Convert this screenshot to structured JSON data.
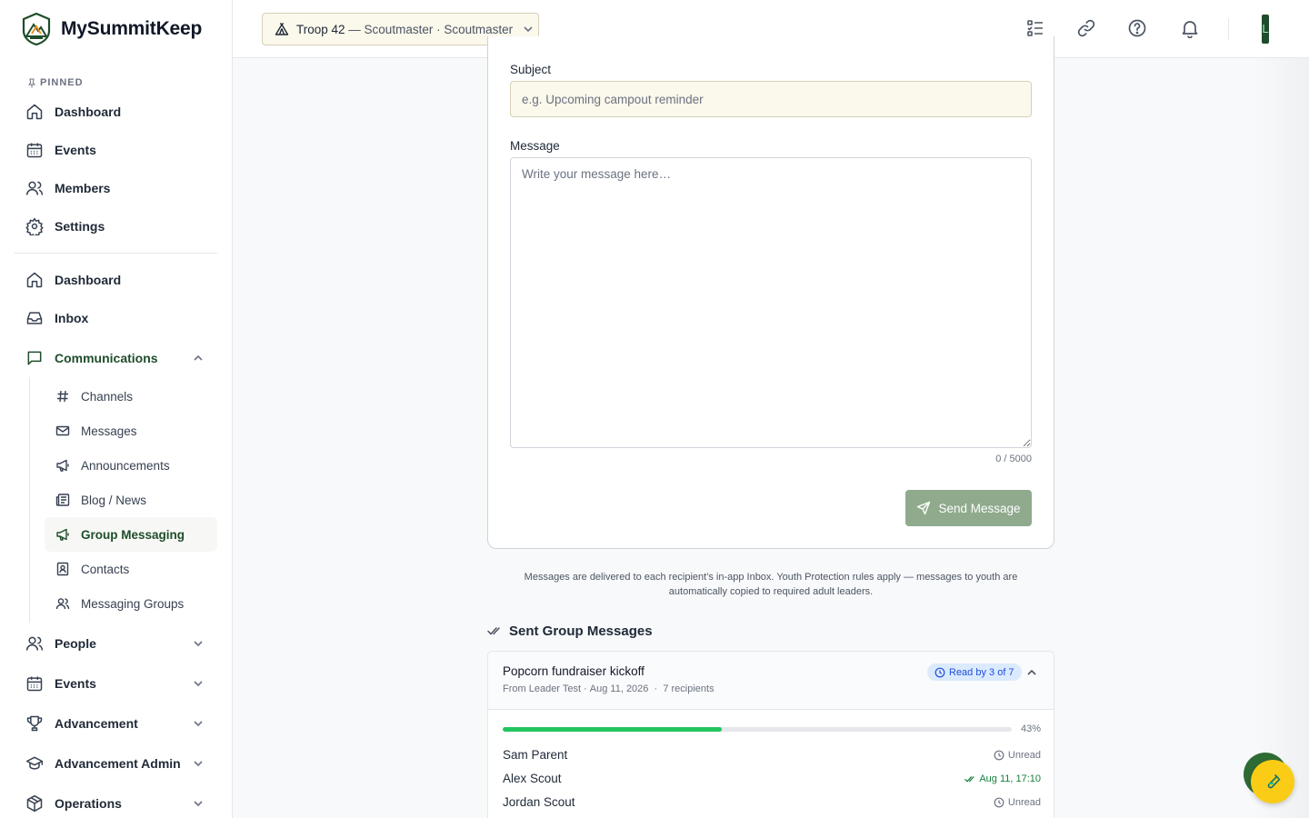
{
  "brand": {
    "name": "MySummitKeep"
  },
  "sidebar": {
    "pinned_label": "PINNED",
    "pinned": [
      {
        "label": "Dashboard",
        "icon": "home-icon"
      },
      {
        "label": "Events",
        "icon": "calendar-icon"
      },
      {
        "label": "Members",
        "icon": "users-icon"
      },
      {
        "label": "Settings",
        "icon": "gear-icon"
      }
    ],
    "main": [
      {
        "label": "Dashboard",
        "icon": "home-icon"
      },
      {
        "label": "Inbox",
        "icon": "inbox-icon"
      },
      {
        "label": "Communications",
        "icon": "chat-bubble-icon",
        "expanded": true,
        "active": true
      }
    ],
    "communications_sub": [
      {
        "label": "Channels",
        "icon": "hash-icon"
      },
      {
        "label": "Messages",
        "icon": "mail-icon"
      },
      {
        "label": "Announcements",
        "icon": "megaphone-icon"
      },
      {
        "label": "Blog / News",
        "icon": "newspaper-icon"
      },
      {
        "label": "Group Messaging",
        "icon": "megaphone-icon",
        "active": true
      },
      {
        "label": "Contacts",
        "icon": "contact-card-icon"
      },
      {
        "label": "Messaging Groups",
        "icon": "users-icon"
      }
    ],
    "sections": [
      {
        "label": "People",
        "icon": "users-icon"
      },
      {
        "label": "Events",
        "icon": "calendar-icon"
      },
      {
        "label": "Advancement",
        "icon": "trophy-icon"
      },
      {
        "label": "Advancement Admin",
        "icon": "graduation-cap-icon"
      },
      {
        "label": "Operations",
        "icon": "box-icon"
      }
    ]
  },
  "header": {
    "troop": "Troop 42",
    "troop_role": " — Scoutmaster · Scoutmaster",
    "avatar_initial": "L",
    "icons": [
      "checklist-icon",
      "link-icon",
      "help-icon",
      "bell-icon"
    ]
  },
  "compose": {
    "subject_label": "Subject",
    "subject_value": "",
    "subject_placeholder": "e.g. Upcoming campout reminder",
    "message_label": "Message",
    "message_value": "",
    "message_placeholder": "Write your message here…",
    "counter": "0 / 5000",
    "send_label": "Send Message"
  },
  "notice": "Messages are delivered to each recipient's in-app Inbox. Youth Protection rules apply — messages to youth are automatically copied to required adult leaders.",
  "sent": {
    "title": "Sent Group Messages",
    "messages": [
      {
        "subject": "Popcorn fundraiser kickoff",
        "from": "From Leader Test · ",
        "date": "Aug 11, 2026",
        "separator": "  ·  ",
        "recipients_count": "7 recipients",
        "read_badge": "Read by 3 of 7",
        "progress_percent": 43,
        "progress_label": "43%",
        "recipients": [
          {
            "name": "Sam Parent",
            "status": "Unread",
            "read": false
          },
          {
            "name": "Alex Scout",
            "status": "Aug 11, 17:10",
            "read": true
          },
          {
            "name": "Jordan Scout",
            "status": "Unread",
            "read": false
          }
        ]
      }
    ]
  },
  "colors": {
    "brand_green": "#1f4d2b",
    "input_cream": "#fbf8ec",
    "send_button": "#8faa8c",
    "progress": "#22c55e",
    "read_badge_bg": "#dbeafe",
    "fab": "#facc15"
  }
}
